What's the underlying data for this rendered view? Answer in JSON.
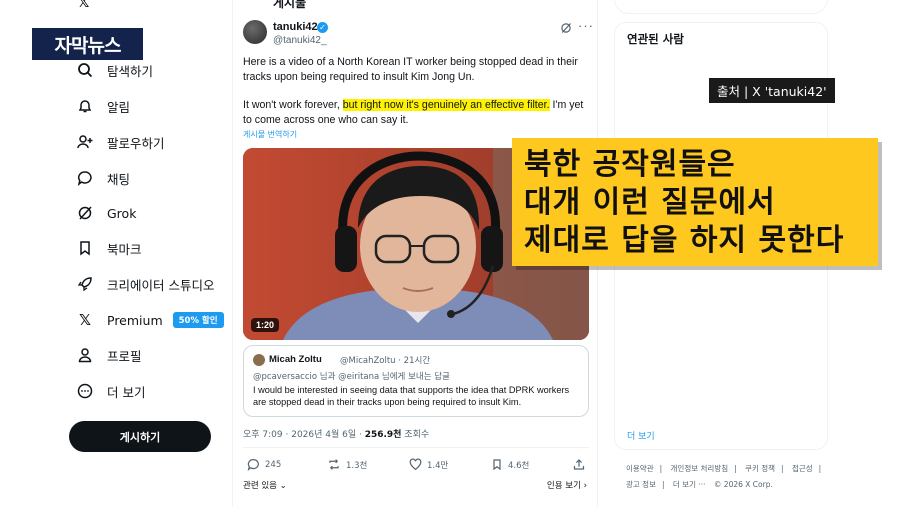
{
  "sidebar": {
    "items": [
      {
        "label": "탐색하기",
        "icon": "search-icon"
      },
      {
        "label": "알림",
        "icon": "bell-icon"
      },
      {
        "label": "팔로우하기",
        "icon": "person-add-icon"
      },
      {
        "label": "채팅",
        "icon": "chat-icon"
      },
      {
        "label": "Grok",
        "icon": "grok-icon"
      },
      {
        "label": "북마크",
        "icon": "bookmark-icon"
      },
      {
        "label": "크리에이터 스튜디오",
        "icon": "rocket-icon"
      },
      {
        "label": "Premium",
        "icon": "x-logo-icon",
        "badge": "50% 할인"
      },
      {
        "label": "프로필",
        "icon": "profile-icon"
      },
      {
        "label": "더 보기",
        "icon": "more-circle-icon"
      }
    ],
    "post_button": "게시하기"
  },
  "overlay": {
    "logo": "자막뉴스",
    "source": "출처 | X 'tanuki42'",
    "caption_lines": [
      "북한 공작원들은",
      "대개 이런 질문에서",
      "제대로 답을 하지 못한다"
    ],
    "caption_color": "#ffc81e"
  },
  "header": {
    "title": "게시물"
  },
  "tweet": {
    "author": "tanuki42",
    "handle": "@tanuki42_",
    "paragraph1": "Here is a video of a North Korean IT worker being stopped dead in their tracks upon being required to insult Kim Jong Un.",
    "p2_before": "It won't work forever, ",
    "p2_highlight": "but right now it's genuinely an effective filter.",
    "p2_after": " I'm yet to come across one who can say it.",
    "translate": "게시물 번역하기",
    "video_duration": "1:20",
    "quote": {
      "name": "Micah Zoltu",
      "meta": "@MicahZoltu · 21시간",
      "reply_to": "@pcaversaccio 님과 @eiritana 님에게 보내는 답글",
      "text": "I would be interested in seeing data that supports the idea that DPRK workers are stopped dead in their tracks upon being required to insult Kim."
    },
    "time": "오후 7:09 · 2026년 4월 6일 · ",
    "views": "256.9천",
    "views_label": " 조회수",
    "actions": {
      "replies": "245",
      "reposts": "1.3천",
      "likes": "1.4만",
      "bookmarks": "4.6천"
    },
    "related_label": "관련 있음",
    "quotes_label": "인용 보기"
  },
  "right": {
    "related_people": "연관된 사람",
    "show_more": "더 보기",
    "footer": [
      "이용약관",
      "개인정보 처리방침",
      "쿠키 정책",
      "접근성",
      "광고 정보",
      "더 보기 ···",
      "© 2026 X Corp."
    ]
  },
  "colors": {
    "accent": "#1d9bf0",
    "highlight": "#fff200"
  }
}
